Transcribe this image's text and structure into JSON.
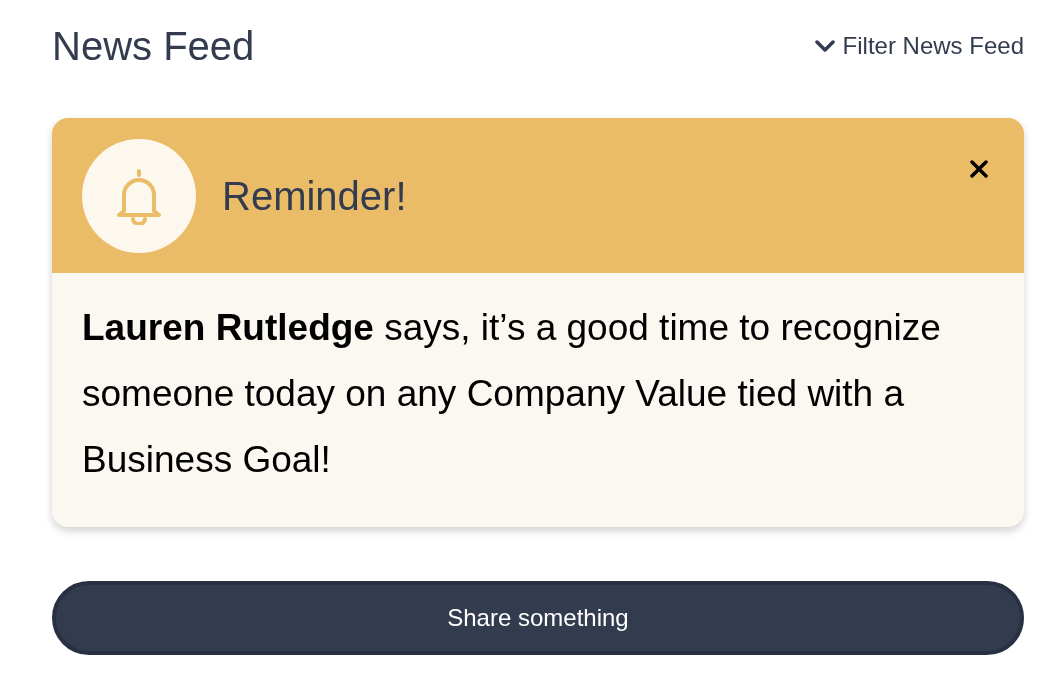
{
  "header": {
    "title": "News Feed",
    "filter_label": "Filter News Feed"
  },
  "reminder": {
    "title": "Reminder!",
    "message": "**Lauren Rutledge** says, it’s a good time to recognize someone today on any Company Value tied with a Business Goal!"
  },
  "share_button": {
    "label": "Share something"
  }
}
